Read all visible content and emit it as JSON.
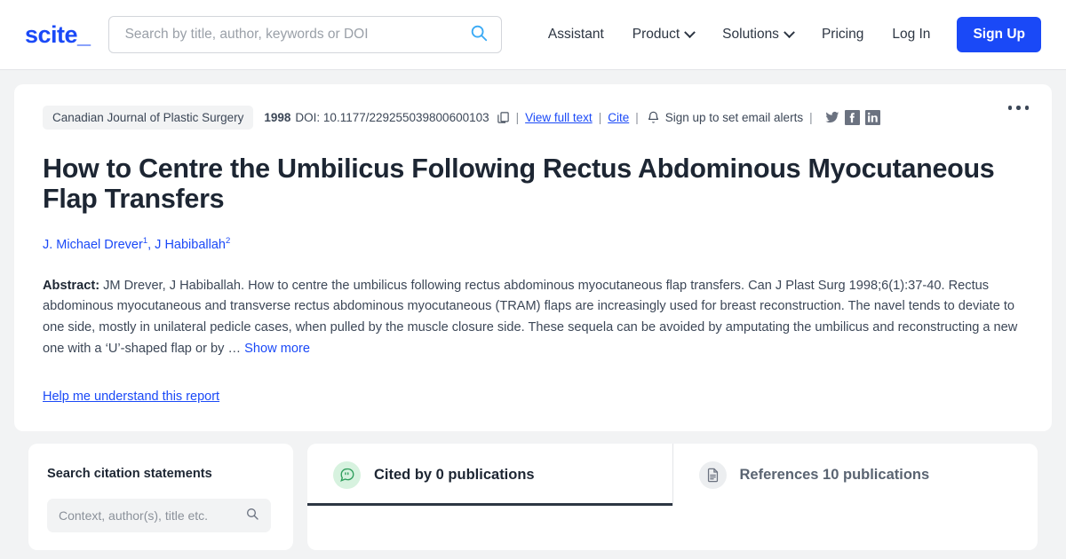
{
  "header": {
    "logo": "scite_",
    "search": {
      "placeholder": "Search by title, author, keywords or DOI",
      "value": "",
      "icon": "search-icon"
    },
    "nav": [
      {
        "label": "Assistant",
        "caret": false
      },
      {
        "label": "Product",
        "caret": true
      },
      {
        "label": "Solutions",
        "caret": true
      },
      {
        "label": "Pricing",
        "caret": false
      },
      {
        "label": "Log In",
        "caret": false
      }
    ],
    "signup_label": "Sign Up"
  },
  "article": {
    "journal": "Canadian Journal of Plastic Surgery",
    "year": "1998",
    "doi": "DOI: 10.1177/229255039800600103",
    "copy_icon": "copy-icon",
    "view_full_text": "View full text",
    "cite": "Cite",
    "bell_icon": "bell-icon",
    "email_alerts": "Sign up to set email alerts",
    "separator": "|",
    "socials": [
      "twitter-icon",
      "facebook-icon",
      "linkedin-icon"
    ],
    "more_icon": "more-options-icon",
    "title": "How to Centre the Umbilicus Following Rectus Abdominous Myocutaneous Flap Transfers",
    "authors": [
      {
        "name": "J. Michael Drever",
        "affiliation": "1"
      },
      {
        "name": "J Habiballah",
        "affiliation": "2"
      }
    ],
    "authors_separator": ", ",
    "abstract_label": "Abstract:",
    "abstract_text": " JM Drever, J Habiballah. How to centre the umbilicus following rectus abdominous myocutaneous flap transfers. Can J Plast Surg 1998;6(1):37-40. Rectus abdominous myocutaneous and transverse rectus abdominous myocutaneous (TRAM) flaps are increasingly used for breast reconstruction. The navel tends to deviate to one side, mostly in unilateral pedicle cases, when pulled by the muscle closure side. These sequela can be avoided by amputating the umbilicus and reconstructing a new one with a ‘U’-shaped flap or by … ",
    "show_more": "Show more",
    "help_link": "Help me understand this report"
  },
  "sidebar": {
    "title": "Search citation statements",
    "search": {
      "placeholder": "Context, author(s), title etc.",
      "value": "",
      "icon": "search-icon"
    }
  },
  "tabs": [
    {
      "label": "Cited by 0 publications",
      "icon": "quote-bubble-icon",
      "active": true
    },
    {
      "label": "References 10 publications",
      "icon": "document-icon",
      "active": false
    }
  ],
  "colors": {
    "brand_blue": "#1a49f7",
    "search_icon_blue": "#3aaaf5",
    "page_background": "#f2f3f4",
    "card_background": "#ffffff",
    "text_dark": "#1d2633",
    "text_body": "#3c4757",
    "tab_active_underline": "#2d3643",
    "tab_icon_green_bg": "#d7f2df",
    "tab_icon_green_fg": "#2f9e5c",
    "social_icon_grey": "#6b7280"
  }
}
